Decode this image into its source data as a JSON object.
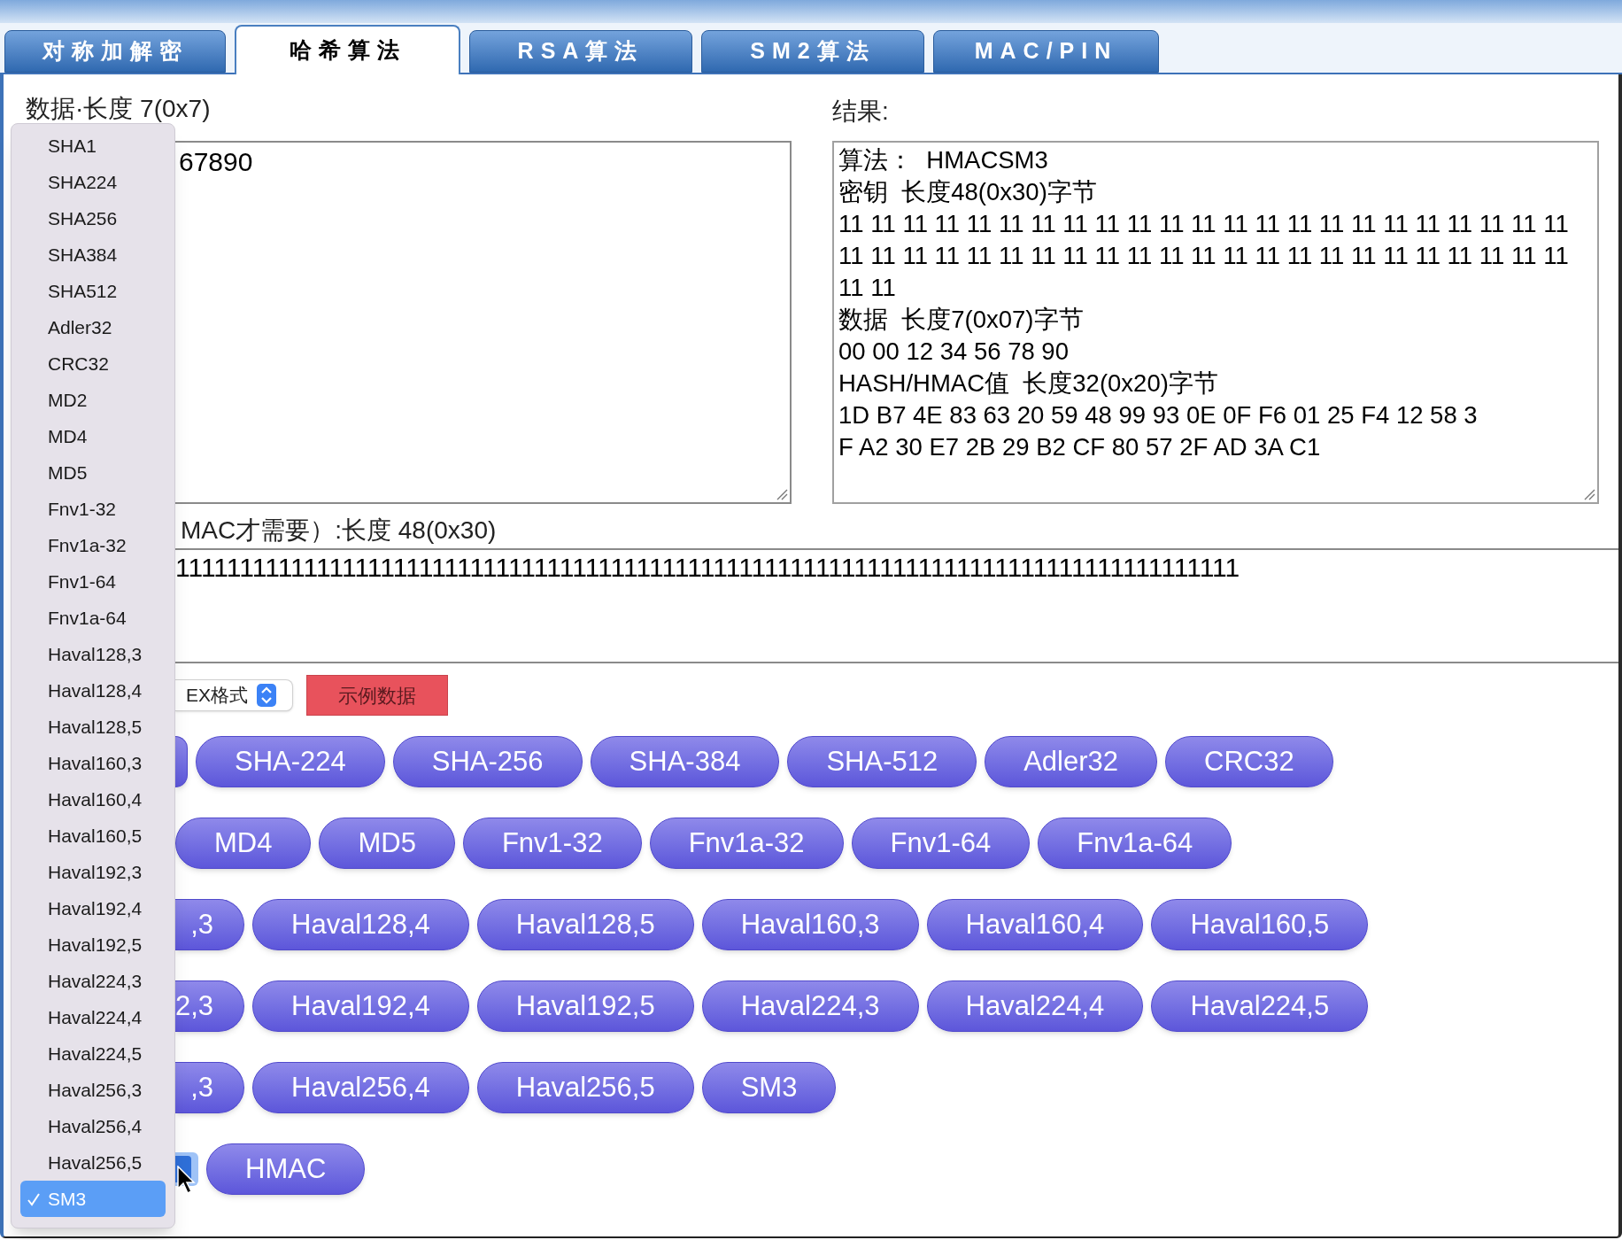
{
  "tabs": [
    {
      "label": "对称加解密",
      "selected": false
    },
    {
      "label": "哈希算法",
      "selected": true
    },
    {
      "label": "RSA算法",
      "selected": false
    },
    {
      "label": "SM2算法",
      "selected": false
    },
    {
      "label": "MAC/PIN",
      "selected": false
    }
  ],
  "data": {
    "label": "数据·长度 7(0x7)",
    "value": "67890"
  },
  "result": {
    "label": "结果:",
    "lines": [
      "算法：  HMACSM3",
      "密钥  长度48(0x30)字节",
      "11 11 11 11 11 11 11 11 11 11 11 11 11 11 11 11 11 11 11 11 11 11 11",
      "11 11 11 11 11 11 11 11 11 11 11 11 11 11 11 11 11 11 11 11 11 11 11",
      "11 11",
      "数据  长度7(0x07)字节",
      "00 00 12 34 56 78 90",
      "HASH/HMAC值  长度32(0x20)字节",
      "1D B7 4E 83 63 20 59 48 99 93 0E 0F F6 01 25 F4 12 58 3",
      "F A2 30 E7 2B 29 B2 CF 80 57 2F AD 3A C1"
    ]
  },
  "key": {
    "label": "MAC才需要）:长度 48(0x30)",
    "value": "11111111111111111111111111111111111111111111111111111111111111111111111111111111111"
  },
  "format_select": {
    "value": "EX格式"
  },
  "sample_button": "示例数据",
  "algorithm_rows": [
    [
      {
        "kind": "edge"
      },
      {
        "kind": "button",
        "label": "SHA-224"
      },
      {
        "kind": "button",
        "label": "SHA-256"
      },
      {
        "kind": "button",
        "label": "SHA-384"
      },
      {
        "kind": "button",
        "label": "SHA-512"
      },
      {
        "kind": "button",
        "label": "Adler32"
      },
      {
        "kind": "button",
        "label": "CRC32"
      }
    ],
    [
      {
        "kind": "button",
        "label": "MD4"
      },
      {
        "kind": "button",
        "label": "MD5"
      },
      {
        "kind": "button",
        "label": "Fnv1-32"
      },
      {
        "kind": "button",
        "label": "Fnv1a-32"
      },
      {
        "kind": "button",
        "label": "Fnv1-64"
      },
      {
        "kind": "button",
        "label": "Fnv1a-64"
      }
    ],
    [
      {
        "kind": "partial",
        "label": ",3"
      },
      {
        "kind": "button",
        "label": "Haval128,4"
      },
      {
        "kind": "button",
        "label": "Haval128,5"
      },
      {
        "kind": "button",
        "label": "Haval160,3"
      },
      {
        "kind": "button",
        "label": "Haval160,4"
      },
      {
        "kind": "button",
        "label": "Haval160,5"
      }
    ],
    [
      {
        "kind": "partial",
        "label": "2,3"
      },
      {
        "kind": "button",
        "label": "Haval192,4"
      },
      {
        "kind": "button",
        "label": "Haval192,5"
      },
      {
        "kind": "button",
        "label": "Haval224,3"
      },
      {
        "kind": "button",
        "label": "Haval224,4"
      },
      {
        "kind": "button",
        "label": "Haval224,5"
      }
    ],
    [
      {
        "kind": "partial",
        "label": ",3"
      },
      {
        "kind": "button",
        "label": "Haval256,4"
      },
      {
        "kind": "button",
        "label": "Haval256,5"
      },
      {
        "kind": "button",
        "label": "SM3"
      }
    ],
    [
      {
        "kind": "select_edge"
      },
      {
        "kind": "button",
        "label": "HMAC"
      }
    ]
  ],
  "dropdown": {
    "items": [
      {
        "label": "SHA1",
        "selected": false
      },
      {
        "label": "SHA224",
        "selected": false
      },
      {
        "label": "SHA256",
        "selected": false
      },
      {
        "label": "SHA384",
        "selected": false
      },
      {
        "label": "SHA512",
        "selected": false
      },
      {
        "label": "Adler32",
        "selected": false
      },
      {
        "label": "CRC32",
        "selected": false
      },
      {
        "label": "MD2",
        "selected": false
      },
      {
        "label": "MD4",
        "selected": false
      },
      {
        "label": "MD5",
        "selected": false
      },
      {
        "label": "Fnv1-32",
        "selected": false
      },
      {
        "label": "Fnv1a-32",
        "selected": false
      },
      {
        "label": "Fnv1-64",
        "selected": false
      },
      {
        "label": "Fnv1a-64",
        "selected": false
      },
      {
        "label": "Haval128,3",
        "selected": false
      },
      {
        "label": "Haval128,4",
        "selected": false
      },
      {
        "label": "Haval128,5",
        "selected": false
      },
      {
        "label": "Haval160,3",
        "selected": false
      },
      {
        "label": "Haval160,4",
        "selected": false
      },
      {
        "label": "Haval160,5",
        "selected": false
      },
      {
        "label": "Haval192,3",
        "selected": false
      },
      {
        "label": "Haval192,4",
        "selected": false
      },
      {
        "label": "Haval192,5",
        "selected": false
      },
      {
        "label": "Haval224,3",
        "selected": false
      },
      {
        "label": "Haval224,4",
        "selected": false
      },
      {
        "label": "Haval224,5",
        "selected": false
      },
      {
        "label": "Haval256,3",
        "selected": false
      },
      {
        "label": "Haval256,4",
        "selected": false
      },
      {
        "label": "Haval256,5",
        "selected": false
      },
      {
        "label": "SM3",
        "selected": true
      }
    ]
  }
}
